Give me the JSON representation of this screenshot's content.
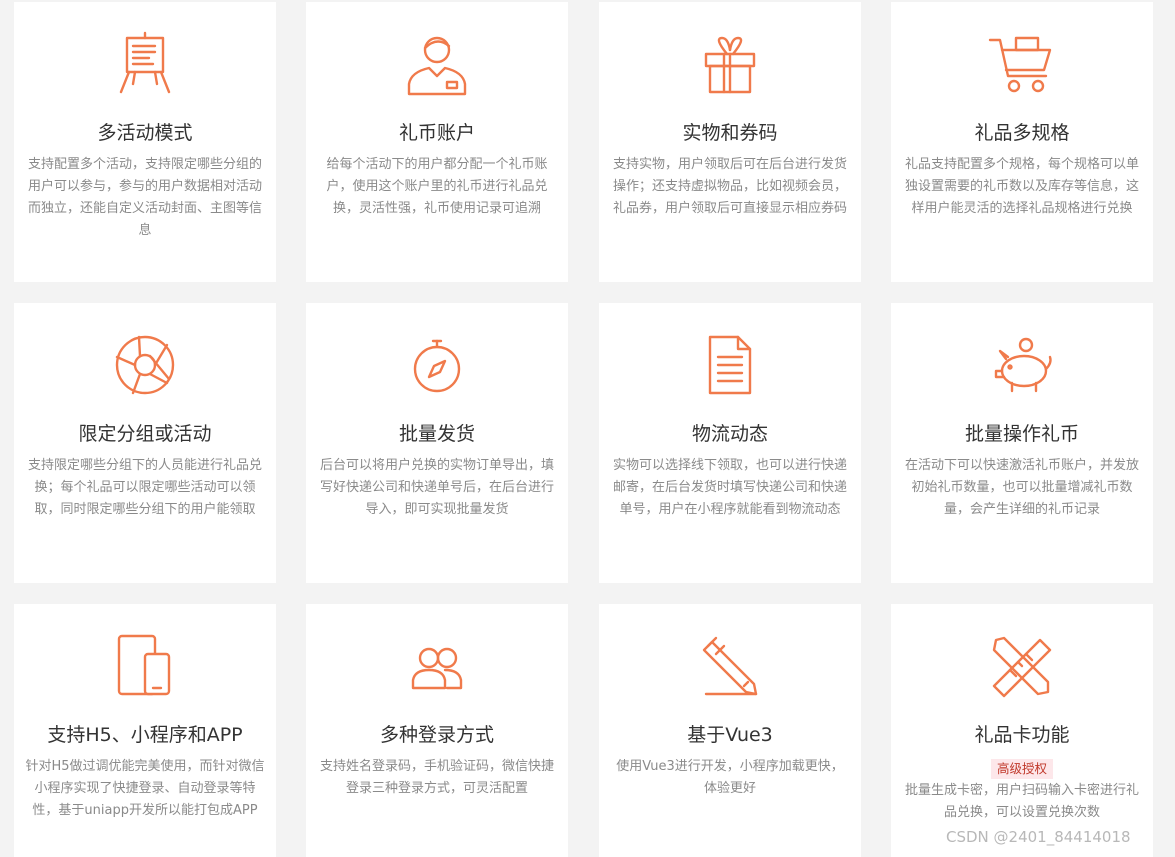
{
  "accent": "#f07a4b",
  "cards": [
    {
      "icon": "easel-icon",
      "title": "多活动模式",
      "desc": "支持配置多个活动，支持限定哪些分组的用户可以参与，参与的用户数据相对活动而独立，还能自定义活动封面、主图等信息"
    },
    {
      "icon": "user-id-icon",
      "title": "礼币账户",
      "desc": "给每个活动下的用户都分配一个礼币账户，使用这个账户里的礼币进行礼品兑换，灵活性强，礼币使用记录可追溯"
    },
    {
      "icon": "gift-icon",
      "title": "实物和券码",
      "desc": "支持实物，用户领取后可在后台进行发货操作；还支持虚拟物品，比如视频会员，礼品券，用户领取后可直接显示相应券码"
    },
    {
      "icon": "shopping-cart-icon",
      "title": "礼品多规格",
      "desc": "礼品支持配置多个规格，每个规格可以单独设置需要的礼币数以及库存等信息，这样用户能灵活的选择礼品规格进行兑换"
    },
    {
      "icon": "aperture-icon",
      "title": "限定分组或活动",
      "desc": "支持限定哪些分组下的人员能进行礼品兑换；每个礼品可以限定哪些活动可以领取，同时限定哪些分组下的用户能领取"
    },
    {
      "icon": "compass-icon",
      "title": "批量发货",
      "desc": "后台可以将用户兑换的实物订单导出，填写好快递公司和快递单号后，在后台进行导入，即可实现批量发货"
    },
    {
      "icon": "document-icon",
      "title": "物流动态",
      "desc": "实物可以选择线下领取，也可以进行快递邮寄，在后台发货时填写快递公司和快递单号，用户在小程序就能看到物流动态"
    },
    {
      "icon": "piggy-bank-icon",
      "title": "批量操作礼币",
      "desc": "在活动下可以快速激活礼币账户，并发放初始礼币数量，也可以批量增减礼币数量，会产生详细的礼币记录"
    },
    {
      "icon": "tablet-phone-icon",
      "title": "支持H5、小程序和APP",
      "desc": "针对H5做过调优能完美使用，而针对微信小程序实现了快捷登录、自动登录等特性，基于uniapp开发所以能打包成APP"
    },
    {
      "icon": "users-icon",
      "title": "多种登录方式",
      "desc": "支持姓名登录码，手机验证码，微信快捷登录三种登录方式，可灵活配置"
    },
    {
      "icon": "pencil-icon",
      "title": "基于Vue3",
      "desc": "使用Vue3进行开发，小程序加载更快，体验更好"
    },
    {
      "icon": "ruler-pencil-icon",
      "title": "礼品卡功能",
      "badge": "高级授权",
      "desc": "批量生成卡密，用户扫码输入卡密进行礼品兑换，可以设置兑换次数"
    }
  ],
  "watermark": "CSDN @2401_84414018"
}
